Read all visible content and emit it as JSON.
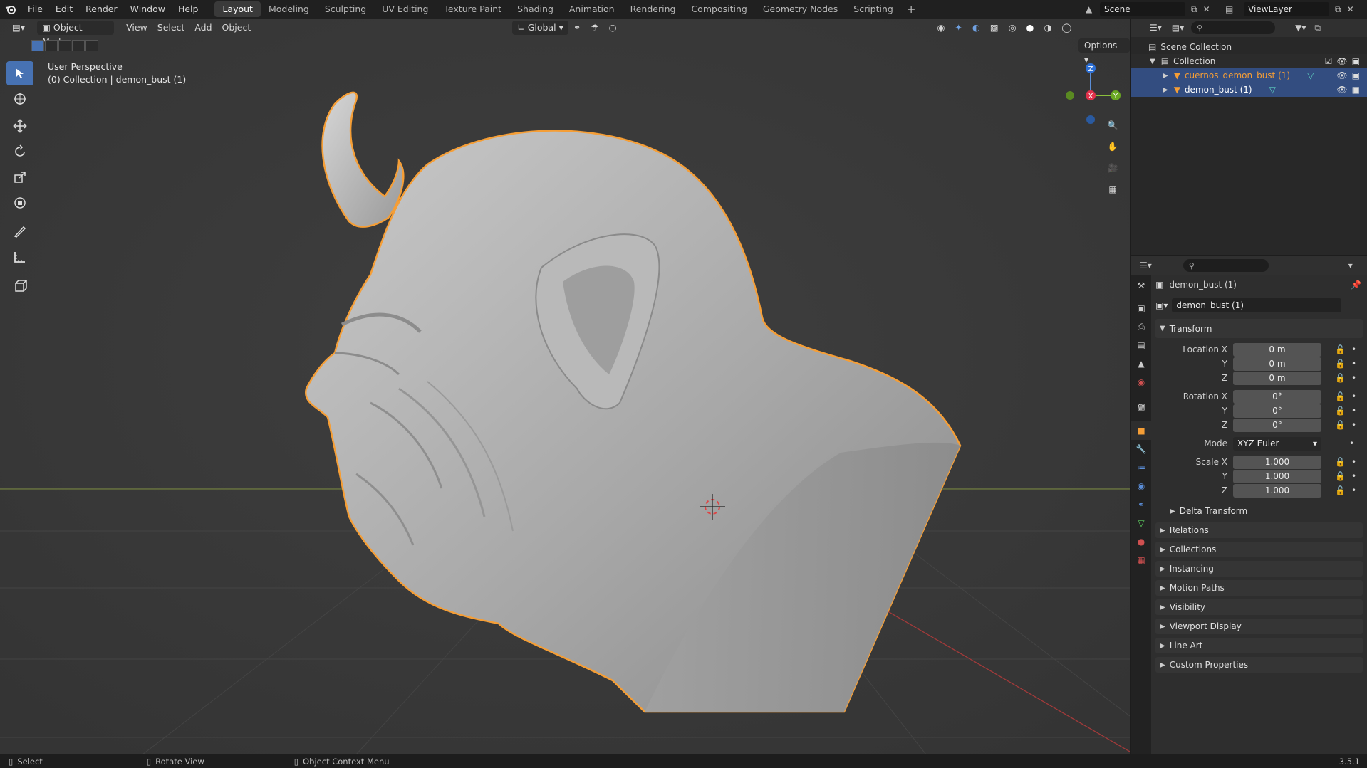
{
  "menubar": {
    "items": [
      "File",
      "Edit",
      "Render",
      "Window",
      "Help"
    ],
    "workspaces": [
      "Layout",
      "Modeling",
      "Sculpting",
      "UV Editing",
      "Texture Paint",
      "Shading",
      "Animation",
      "Rendering",
      "Compositing",
      "Geometry Nodes",
      "Scripting"
    ],
    "active_workspace": "Layout",
    "add_tab": "+",
    "scene": "Scene",
    "view_layer": "ViewLayer"
  },
  "viewport": {
    "mode": "Object Mode",
    "menus": [
      "View",
      "Select",
      "Add",
      "Object"
    ],
    "transform_orientation": "Global",
    "options_label": "Options",
    "view_name": "User Perspective",
    "collection_info": "(0) Collection | demon_bust (1)",
    "gizmo": {
      "z": "Z",
      "y": "Y",
      "x": "X"
    },
    "accent": "#4772b3",
    "selection_outline": "#f59e36"
  },
  "outliner": {
    "root": "Scene Collection",
    "collection": "Collection",
    "objects": [
      {
        "name": "cuernos_demon_bust (1)",
        "color": "#f59e36"
      },
      {
        "name": "demon_bust (1)",
        "color": "#ffffff"
      }
    ]
  },
  "properties": {
    "object_name": "demon_bust (1)",
    "datablock_name": "demon_bust (1)",
    "transform_label": "Transform",
    "location_label": "Location X",
    "rotation_label": "Rotation X",
    "scale_label": "Scale X",
    "y_label": "Y",
    "z_label": "Z",
    "location": [
      "0 m",
      "0 m",
      "0 m"
    ],
    "rotation": [
      "0°",
      "0°",
      "0°"
    ],
    "mode_label": "Mode",
    "rotation_mode": "XYZ Euler",
    "scale": [
      "1.000",
      "1.000",
      "1.000"
    ],
    "delta_transform": "Delta Transform",
    "sections": [
      "Relations",
      "Collections",
      "Instancing",
      "Motion Paths",
      "Visibility",
      "Viewport Display",
      "Line Art",
      "Custom Properties"
    ]
  },
  "statusbar": {
    "select": "Select",
    "rotate": "Rotate View",
    "context": "Object Context Menu",
    "version": "3.5.1"
  }
}
